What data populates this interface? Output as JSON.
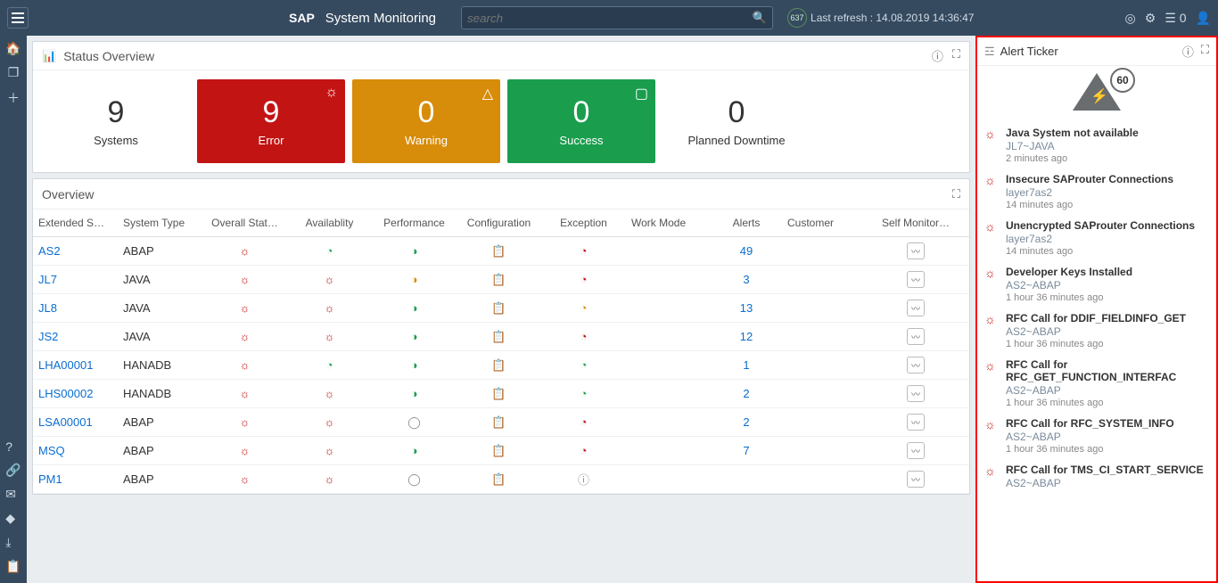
{
  "app": {
    "brand": "SAP",
    "title": "System Monitoring"
  },
  "search": {
    "placeholder": "search"
  },
  "refresh": {
    "badge": "637",
    "label": "Last refresh : 14.08.2019 14:36:47"
  },
  "notifCount": "0",
  "status": {
    "panelTitle": "Status Overview",
    "cards": [
      {
        "value": "9",
        "label": "Systems"
      },
      {
        "value": "9",
        "label": "Error"
      },
      {
        "value": "0",
        "label": "Warning"
      },
      {
        "value": "0",
        "label": "Success"
      },
      {
        "value": "0",
        "label": "Planned Downtime"
      }
    ]
  },
  "overview": {
    "title": "Overview",
    "cols": [
      "Extended S…",
      "System Type",
      "Overall Stat…",
      "Availablity",
      "Performance",
      "Configuration",
      "Exception",
      "Work Mode",
      "Alerts",
      "Customer",
      "Self Monitor…"
    ],
    "rows": [
      {
        "sid": "AS2",
        "type": "ABAP",
        "overall": "red",
        "avail": "green",
        "perf": "green-warn",
        "conf": "red",
        "exc": "red",
        "alerts": "49"
      },
      {
        "sid": "JL7",
        "type": "JAVA",
        "overall": "red",
        "avail": "red",
        "perf": "orange-warn",
        "conf": "red",
        "exc": "red",
        "alerts": "3"
      },
      {
        "sid": "JL8",
        "type": "JAVA",
        "overall": "red",
        "avail": "red",
        "perf": "green-warn",
        "conf": "red",
        "exc": "orange",
        "alerts": "13"
      },
      {
        "sid": "JS2",
        "type": "JAVA",
        "overall": "red",
        "avail": "red",
        "perf": "green-warn",
        "conf": "red",
        "exc": "red",
        "alerts": "12"
      },
      {
        "sid": "LHA00001",
        "type": "HANADB",
        "overall": "red",
        "avail": "green",
        "perf": "green-warn",
        "conf": "red",
        "exc": "green",
        "alerts": "1"
      },
      {
        "sid": "LHS00002",
        "type": "HANADB",
        "overall": "red",
        "avail": "red",
        "perf": "green-warn",
        "conf": "red",
        "exc": "green",
        "alerts": "2"
      },
      {
        "sid": "LSA00001",
        "type": "ABAP",
        "overall": "red",
        "avail": "red",
        "perf": "grey",
        "conf": "red",
        "exc": "red",
        "alerts": "2"
      },
      {
        "sid": "MSQ",
        "type": "ABAP",
        "overall": "red",
        "avail": "red",
        "perf": "green-warn",
        "conf": "red",
        "exc": "red",
        "alerts": "7"
      },
      {
        "sid": "PM1",
        "type": "ABAP",
        "overall": "red",
        "avail": "red",
        "perf": "grey",
        "conf": "grey-cb",
        "exc": "grey-info",
        "alerts": ""
      }
    ]
  },
  "ticker": {
    "title": "Alert Ticker",
    "count": "60",
    "alerts": [
      {
        "title": "Java System not available",
        "sub": "JL7~JAVA",
        "time": "2 minutes ago"
      },
      {
        "title": "Insecure SAProuter Connections",
        "sub": "layer7as2",
        "time": "14 minutes ago"
      },
      {
        "title": "Unencrypted SAProuter Connections",
        "sub": "layer7as2",
        "time": "14 minutes ago"
      },
      {
        "title": "Developer Keys Installed",
        "sub": "AS2~ABAP",
        "time": "1 hour 36 minutes ago"
      },
      {
        "title": "RFC Call for DDIF_FIELDINFO_GET",
        "sub": "AS2~ABAP",
        "time": "1 hour 36 minutes ago"
      },
      {
        "title": "RFC Call for RFC_GET_FUNCTION_INTERFAC",
        "sub": "AS2~ABAP",
        "time": "1 hour 36 minutes ago"
      },
      {
        "title": "RFC Call for RFC_SYSTEM_INFO",
        "sub": "AS2~ABAP",
        "time": "1 hour 36 minutes ago"
      },
      {
        "title": "RFC Call for TMS_CI_START_SERVICE",
        "sub": "AS2~ABAP",
        "time": ""
      }
    ]
  }
}
